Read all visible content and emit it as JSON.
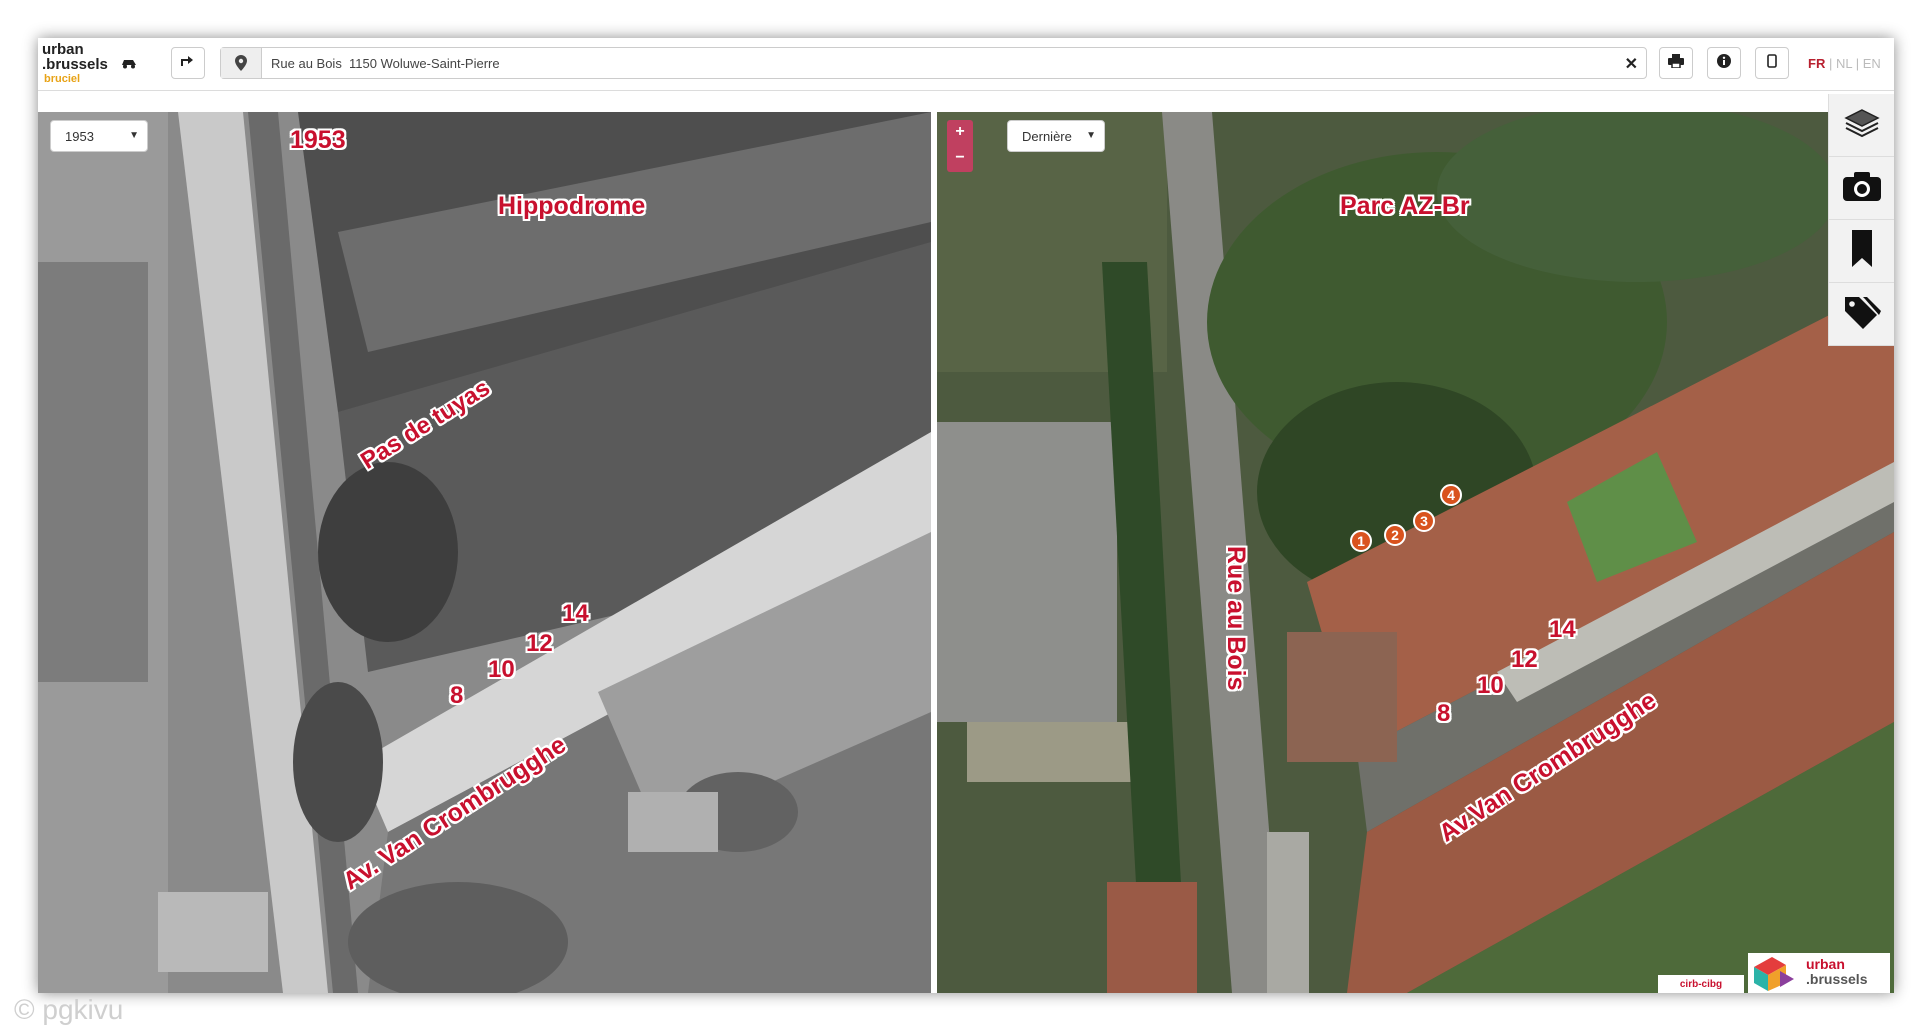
{
  "app": {
    "logo_line1": "urban",
    "logo_line2": ".brussels",
    "logo_line3": "bruciel"
  },
  "search": {
    "value": "Rue au Bois  1150 Woluwe-Saint-Pierre",
    "placeholder": ""
  },
  "languages": {
    "fr": "FR",
    "sep1": " | ",
    "nl": "NL",
    "sep2": " | ",
    "en": "EN",
    "active": "FR"
  },
  "left_map": {
    "year_select": "1953",
    "labels": {
      "year": "1953",
      "hippodrome": "Hippodrome",
      "tuyas": "Pas de tuyas",
      "avenue": "Av. Van Crombrugghe",
      "n14": "14",
      "n12": "12",
      "n10": "10",
      "n8": "8"
    }
  },
  "right_map": {
    "year_select": "Dernière",
    "zoom_in": "+",
    "zoom_out": "−",
    "labels": {
      "parc": "Parc AZ-Br",
      "rue": "Rue au Bois",
      "avenue": "Av.Van Crombrugghe",
      "n14": "14",
      "n12": "12",
      "n10": "10",
      "n8": "8"
    },
    "markers": [
      "1",
      "2",
      "3",
      "4"
    ],
    "credit_cirb": "cirb-cibg",
    "credit_urban_1": "urban",
    "credit_urban_2": ".brussels"
  },
  "watermark": "© pgkivu",
  "colors": {
    "label_red": "#c8102e",
    "marker_orange": "#d9531e",
    "logo_yellow": "#e8a317",
    "zoom_pink": "#c04060"
  },
  "icons": [
    "directions-icon",
    "map-pin-icon",
    "close-icon",
    "print-icon",
    "info-icon",
    "mobile-icon",
    "layers-icon",
    "camera-icon",
    "bookmark-icon",
    "tags-icon"
  ]
}
